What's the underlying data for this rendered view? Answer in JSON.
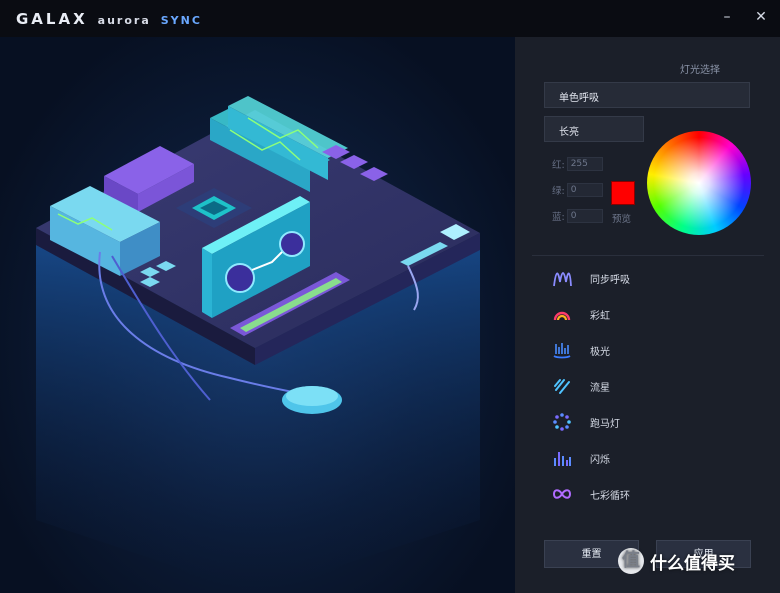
{
  "titlebar": {
    "brand": "GALAX",
    "brand_sub_a": "aurora",
    "brand_sub_b": "SYNC",
    "minimize_glyph": "–",
    "close_glyph": "✕"
  },
  "panel": {
    "section_label": "灯光选择",
    "mode_dropdown": "单色呼吸",
    "duration_dropdown": "长亮",
    "rgb": {
      "red_label": "红:",
      "red_value": "255",
      "green_label": "绿:",
      "green_value": "0",
      "blue_label": "蓝:",
      "blue_value": "0"
    },
    "preview_label": "预览",
    "preview_color": "#ff0000",
    "effects": [
      {
        "label": "同步呼吸",
        "icon": "sync-breath-icon"
      },
      {
        "label": "彩虹",
        "icon": "rainbow-icon"
      },
      {
        "label": "极光",
        "icon": "aurora-icon"
      },
      {
        "label": "流星",
        "icon": "meteor-icon"
      },
      {
        "label": "跑马灯",
        "icon": "marquee-icon"
      },
      {
        "label": "闪烁",
        "icon": "flash-icon"
      },
      {
        "label": "七彩循环",
        "icon": "color-cycle-icon"
      }
    ],
    "reset_button": "重置",
    "apply_button": "应用"
  },
  "watermark": {
    "badge": "值",
    "text": "什么值得买"
  }
}
